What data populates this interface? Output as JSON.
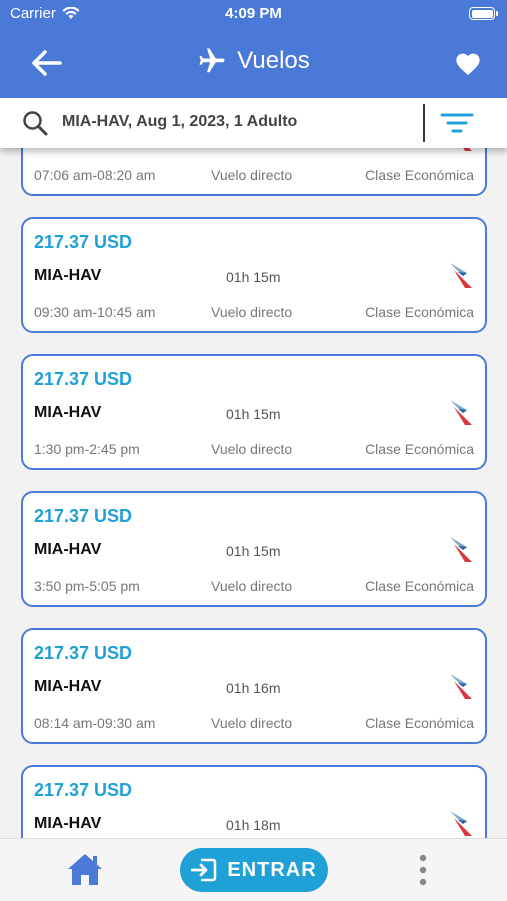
{
  "status": {
    "carrier": "Carrier",
    "time": "4:09 PM"
  },
  "header": {
    "title": "Vuelos",
    "back_icon": "arrow-left-icon",
    "plane_icon": "airplane-icon",
    "fav_icon": "heart-icon"
  },
  "search": {
    "text": "MIA-HAV, Aug 1, 2023, 1 Adulto"
  },
  "flights": [
    {
      "price": "",
      "route": "",
      "duration": "",
      "times": "07:06 am-08:20 am",
      "type": "Vuelo directo",
      "class": "Clase Económica"
    },
    {
      "price": "217.37 USD",
      "route": "MIA-HAV",
      "duration": "01h 15m",
      "times": "09:30 am-10:45 am",
      "type": "Vuelo directo",
      "class": "Clase Económica"
    },
    {
      "price": "217.37 USD",
      "route": "MIA-HAV",
      "duration": "01h 15m",
      "times": "1:30 pm-2:45 pm",
      "type": "Vuelo directo",
      "class": "Clase Económica"
    },
    {
      "price": "217.37 USD",
      "route": "MIA-HAV",
      "duration": "01h 15m",
      "times": "3:50 pm-5:05 pm",
      "type": "Vuelo directo",
      "class": "Clase Económica"
    },
    {
      "price": "217.37 USD",
      "route": "MIA-HAV",
      "duration": "01h 16m",
      "times": "08:14 am-09:30 am",
      "type": "Vuelo directo",
      "class": "Clase Económica"
    },
    {
      "price": "217.37 USD",
      "route": "MIA-HAV",
      "duration": "01h 18m",
      "times": "",
      "type": "",
      "class": ""
    }
  ],
  "bottom": {
    "enter_label": "ENTRAR"
  },
  "colors": {
    "primary": "#4a79d8",
    "accent": "#1fa1d8"
  }
}
